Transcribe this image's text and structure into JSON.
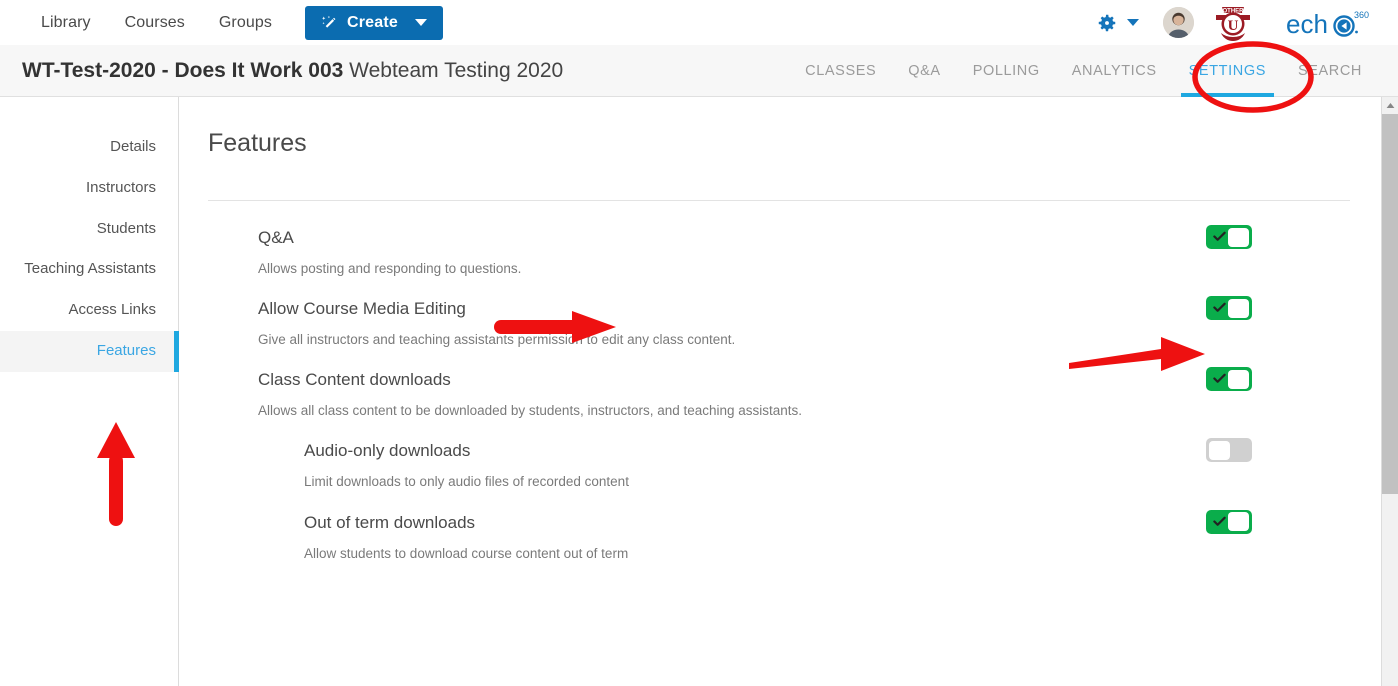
{
  "topnav": {
    "links": [
      {
        "label": "Library"
      },
      {
        "label": "Courses"
      },
      {
        "label": "Groups"
      }
    ],
    "create_label": "Create",
    "icons": {
      "wand": "magic-wand-icon",
      "gear": "gear-icon",
      "caret": "chevron-down-icon",
      "avatar": "user-avatar",
      "institution_logo": "other-u-logo",
      "product_logo": "echo360-logo"
    },
    "institution_logo_text": "OTHER",
    "product_logo_text": "echo",
    "product_logo_sup": "360"
  },
  "course": {
    "code": "WT-Test-2020 - Does It Work 003",
    "name": "Webteam Testing 2020",
    "tabs": [
      {
        "label": "CLASSES",
        "active": false
      },
      {
        "label": "Q&A",
        "active": false
      },
      {
        "label": "POLLING",
        "active": false
      },
      {
        "label": "ANALYTICS",
        "active": false
      },
      {
        "label": "SETTINGS",
        "active": true
      },
      {
        "label": "SEARCH",
        "active": false
      }
    ]
  },
  "sidebar": {
    "items": [
      {
        "label": "Details",
        "active": false
      },
      {
        "label": "Instructors",
        "active": false
      },
      {
        "label": "Students",
        "active": false
      },
      {
        "label": "Teaching Assistants",
        "active": false
      },
      {
        "label": "Access Links",
        "active": false
      },
      {
        "label": "Features",
        "active": true
      }
    ]
  },
  "main": {
    "page_title": "Features",
    "features": [
      {
        "name": "Q&A",
        "desc": "Allows posting and responding to questions.",
        "toggle": "on",
        "sub": false
      },
      {
        "name": "Allow Course Media Editing",
        "desc": "Give all instructors and teaching assistants permission to edit any class content.",
        "toggle": "on",
        "sub": false
      },
      {
        "name": "Class Content downloads",
        "desc": "Allows all class content to be downloaded by students, instructors, and teaching assistants.",
        "toggle": "on",
        "sub": false
      },
      {
        "name": "Audio-only downloads",
        "desc": "Limit downloads to only audio files of recorded content",
        "toggle": "off",
        "sub": true
      },
      {
        "name": "Out of term downloads",
        "desc": "Allow students to download course content out of term",
        "toggle": "on",
        "sub": true
      }
    ]
  },
  "scrollbar": {
    "up_icon": "scroll-up-arrow-icon"
  },
  "annotations": {
    "color": "#ee1111",
    "ellipse_target": "SETTINGS",
    "arrow_up_target": "Features",
    "arrow_right_media_target": "Allow Course Media Editing",
    "arrow_right_toggle_target": "Allow Course Media Editing toggle"
  },
  "colors": {
    "brand_blue": "#0b6cb0",
    "accent_cyan": "#1fa8e0",
    "toggle_on": "#0aad4b",
    "toggle_off": "#d0d0d0",
    "annotation_red": "#ee1111"
  }
}
